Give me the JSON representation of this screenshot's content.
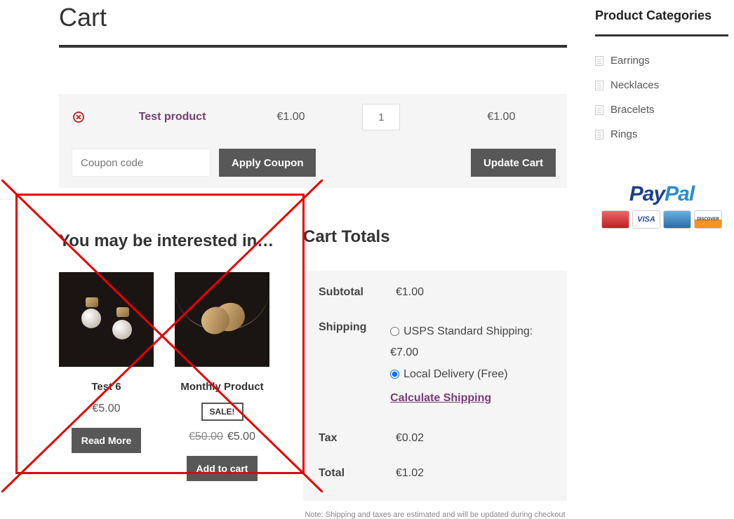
{
  "page": {
    "title": "Cart"
  },
  "cart": {
    "items": [
      {
        "name": "Test product",
        "price": "€1.00",
        "qty": "1",
        "total": "€1.00"
      }
    ],
    "coupon_placeholder": "Coupon code",
    "apply_coupon_label": "Apply Coupon",
    "update_cart_label": "Update Cart"
  },
  "interested": {
    "heading": "You may be interested in…",
    "products": [
      {
        "title": "Test 6",
        "price": "€5.00",
        "button": "Read More"
      },
      {
        "title": "Monthly Product",
        "sale_badge": "SALE!",
        "old_price": "€50.00",
        "price": "€5.00",
        "button": "Add to cart"
      }
    ]
  },
  "totals": {
    "heading": "Cart Totals",
    "rows": {
      "subtotal_label": "Subtotal",
      "subtotal": "€1.00",
      "shipping_label": "Shipping",
      "ship_opt1": "USPS Standard Shipping: €7.00",
      "ship_opt2": "Local Delivery (Free)",
      "calc_link": "Calculate Shipping",
      "tax_label": "Tax",
      "tax": "€0.02",
      "total_label": "Total",
      "total": "€1.02"
    },
    "note": "Note: Shipping and taxes are estimated and will be updated during checkout"
  },
  "sidebar": {
    "heading": "Product Categories",
    "categories": [
      "Earrings",
      "Necklaces",
      "Bracelets",
      "Rings"
    ]
  },
  "payment": {
    "brand_left": "Pay",
    "brand_right": "Pal",
    "cards": {
      "mc": "MasterCard",
      "visa": "VISA",
      "amex": "AMEX",
      "disc": "DISCOVER"
    }
  }
}
